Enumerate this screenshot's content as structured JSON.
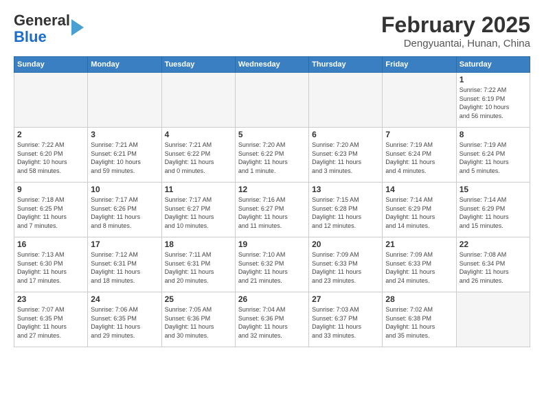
{
  "header": {
    "logo_general": "General",
    "logo_blue": "Blue",
    "month_title": "February 2025",
    "location": "Dengyuantai, Hunan, China"
  },
  "weekdays": [
    "Sunday",
    "Monday",
    "Tuesday",
    "Wednesday",
    "Thursday",
    "Friday",
    "Saturday"
  ],
  "weeks": [
    {
      "days": [
        {
          "num": "",
          "info": ""
        },
        {
          "num": "",
          "info": ""
        },
        {
          "num": "",
          "info": ""
        },
        {
          "num": "",
          "info": ""
        },
        {
          "num": "",
          "info": ""
        },
        {
          "num": "",
          "info": ""
        },
        {
          "num": "1",
          "info": "Sunrise: 7:22 AM\nSunset: 6:19 PM\nDaylight: 10 hours\nand 56 minutes."
        }
      ]
    },
    {
      "days": [
        {
          "num": "2",
          "info": "Sunrise: 7:22 AM\nSunset: 6:20 PM\nDaylight: 10 hours\nand 58 minutes."
        },
        {
          "num": "3",
          "info": "Sunrise: 7:21 AM\nSunset: 6:21 PM\nDaylight: 10 hours\nand 59 minutes."
        },
        {
          "num": "4",
          "info": "Sunrise: 7:21 AM\nSunset: 6:22 PM\nDaylight: 11 hours\nand 0 minutes."
        },
        {
          "num": "5",
          "info": "Sunrise: 7:20 AM\nSunset: 6:22 PM\nDaylight: 11 hours\nand 1 minute."
        },
        {
          "num": "6",
          "info": "Sunrise: 7:20 AM\nSunset: 6:23 PM\nDaylight: 11 hours\nand 3 minutes."
        },
        {
          "num": "7",
          "info": "Sunrise: 7:19 AM\nSunset: 6:24 PM\nDaylight: 11 hours\nand 4 minutes."
        },
        {
          "num": "8",
          "info": "Sunrise: 7:19 AM\nSunset: 6:24 PM\nDaylight: 11 hours\nand 5 minutes."
        }
      ]
    },
    {
      "days": [
        {
          "num": "9",
          "info": "Sunrise: 7:18 AM\nSunset: 6:25 PM\nDaylight: 11 hours\nand 7 minutes."
        },
        {
          "num": "10",
          "info": "Sunrise: 7:17 AM\nSunset: 6:26 PM\nDaylight: 11 hours\nand 8 minutes."
        },
        {
          "num": "11",
          "info": "Sunrise: 7:17 AM\nSunset: 6:27 PM\nDaylight: 11 hours\nand 10 minutes."
        },
        {
          "num": "12",
          "info": "Sunrise: 7:16 AM\nSunset: 6:27 PM\nDaylight: 11 hours\nand 11 minutes."
        },
        {
          "num": "13",
          "info": "Sunrise: 7:15 AM\nSunset: 6:28 PM\nDaylight: 11 hours\nand 12 minutes."
        },
        {
          "num": "14",
          "info": "Sunrise: 7:14 AM\nSunset: 6:29 PM\nDaylight: 11 hours\nand 14 minutes."
        },
        {
          "num": "15",
          "info": "Sunrise: 7:14 AM\nSunset: 6:29 PM\nDaylight: 11 hours\nand 15 minutes."
        }
      ]
    },
    {
      "days": [
        {
          "num": "16",
          "info": "Sunrise: 7:13 AM\nSunset: 6:30 PM\nDaylight: 11 hours\nand 17 minutes."
        },
        {
          "num": "17",
          "info": "Sunrise: 7:12 AM\nSunset: 6:31 PM\nDaylight: 11 hours\nand 18 minutes."
        },
        {
          "num": "18",
          "info": "Sunrise: 7:11 AM\nSunset: 6:31 PM\nDaylight: 11 hours\nand 20 minutes."
        },
        {
          "num": "19",
          "info": "Sunrise: 7:10 AM\nSunset: 6:32 PM\nDaylight: 11 hours\nand 21 minutes."
        },
        {
          "num": "20",
          "info": "Sunrise: 7:09 AM\nSunset: 6:33 PM\nDaylight: 11 hours\nand 23 minutes."
        },
        {
          "num": "21",
          "info": "Sunrise: 7:09 AM\nSunset: 6:33 PM\nDaylight: 11 hours\nand 24 minutes."
        },
        {
          "num": "22",
          "info": "Sunrise: 7:08 AM\nSunset: 6:34 PM\nDaylight: 11 hours\nand 26 minutes."
        }
      ]
    },
    {
      "days": [
        {
          "num": "23",
          "info": "Sunrise: 7:07 AM\nSunset: 6:35 PM\nDaylight: 11 hours\nand 27 minutes."
        },
        {
          "num": "24",
          "info": "Sunrise: 7:06 AM\nSunset: 6:35 PM\nDaylight: 11 hours\nand 29 minutes."
        },
        {
          "num": "25",
          "info": "Sunrise: 7:05 AM\nSunset: 6:36 PM\nDaylight: 11 hours\nand 30 minutes."
        },
        {
          "num": "26",
          "info": "Sunrise: 7:04 AM\nSunset: 6:36 PM\nDaylight: 11 hours\nand 32 minutes."
        },
        {
          "num": "27",
          "info": "Sunrise: 7:03 AM\nSunset: 6:37 PM\nDaylight: 11 hours\nand 33 minutes."
        },
        {
          "num": "28",
          "info": "Sunrise: 7:02 AM\nSunset: 6:38 PM\nDaylight: 11 hours\nand 35 minutes."
        },
        {
          "num": "",
          "info": ""
        }
      ]
    }
  ]
}
